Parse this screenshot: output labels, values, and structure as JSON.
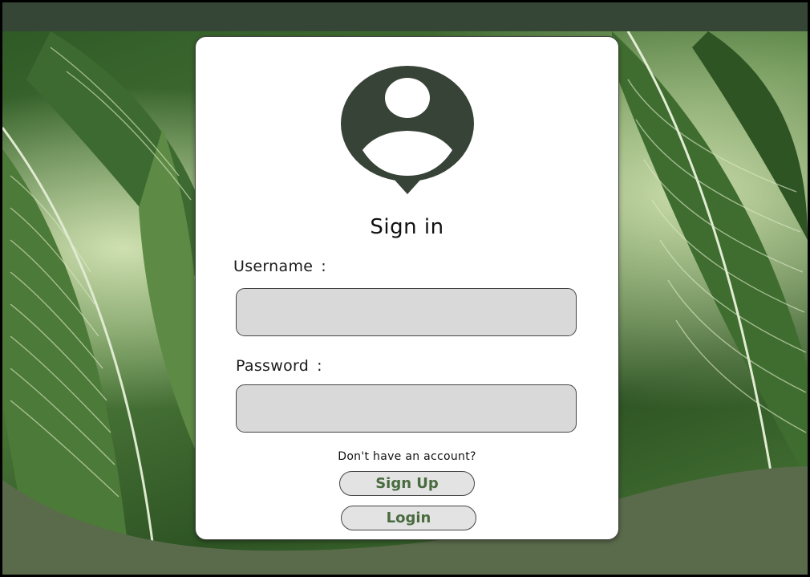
{
  "login_card": {
    "title": "Sign in",
    "username_label": "Username",
    "password_label": "Password",
    "colon": ":",
    "username_value": "",
    "password_value": "",
    "no_account_prompt": "Don't have an account?",
    "signup_label": "Sign Up",
    "login_label": "Login",
    "avatar_icon": "user-location-pin-icon"
  },
  "colors": {
    "top_bar": "#364636",
    "wave": "#5a6b4b",
    "avatar": "#374337",
    "button_text": "#4a6b40",
    "input_bg": "#d9d9d9"
  }
}
